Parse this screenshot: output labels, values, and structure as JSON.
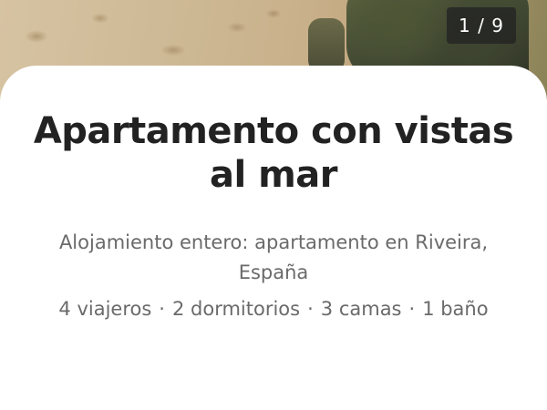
{
  "photo": {
    "counter": "1 / 9"
  },
  "listing": {
    "title": "Apartamento con vistas al mar",
    "subtitle": "Alojamiento entero: apartamento en Riveira, España",
    "details": {
      "guests": "4 viajeros",
      "bedrooms": "2 dormitorios",
      "beds": "3 camas",
      "baths": "1 baño",
      "separator": "·"
    }
  },
  "colors": {
    "title": "#222222",
    "secondary_text": "#6a6a6a",
    "counter_bg": "#222222"
  }
}
